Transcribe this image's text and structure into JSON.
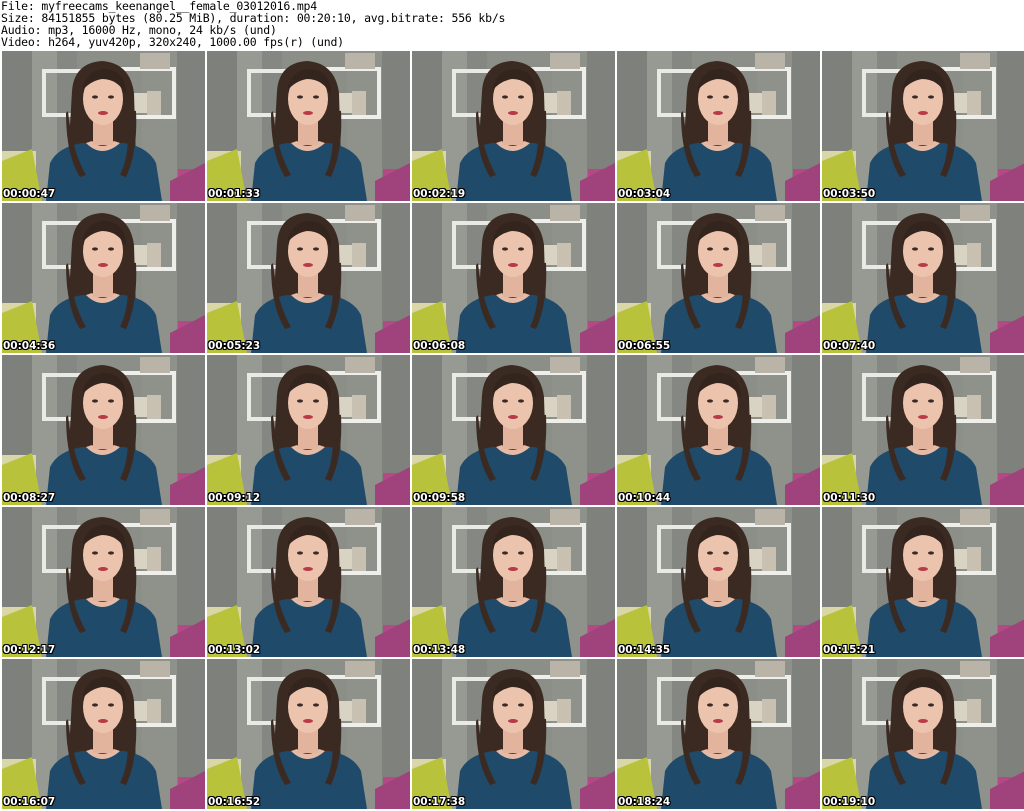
{
  "header": {
    "file_line": "File: myfreecams_keenangel__female_03012016.mp4",
    "size_line": "Size: 84151855 bytes (80.25 MiB), duration: 00:20:10, avg.bitrate: 556 kb/s",
    "audio_line": "Audio: mp3, 16000 Hz, mono, 24 kb/s (und)",
    "video_line": "Video: h264, yuv420p, 320x240, 1000.00 fps(r) (und)"
  },
  "thumbnails": [
    {
      "timestamp": "00:00:47"
    },
    {
      "timestamp": "00:01:33"
    },
    {
      "timestamp": "00:02:19"
    },
    {
      "timestamp": "00:03:04"
    },
    {
      "timestamp": "00:03:50"
    },
    {
      "timestamp": "00:04:36"
    },
    {
      "timestamp": "00:05:23"
    },
    {
      "timestamp": "00:06:08"
    },
    {
      "timestamp": "00:06:55"
    },
    {
      "timestamp": "00:07:40"
    },
    {
      "timestamp": "00:08:27"
    },
    {
      "timestamp": "00:09:12"
    },
    {
      "timestamp": "00:09:58"
    },
    {
      "timestamp": "00:10:44"
    },
    {
      "timestamp": "00:11:30"
    },
    {
      "timestamp": "00:12:17"
    },
    {
      "timestamp": "00:13:02"
    },
    {
      "timestamp": "00:13:48"
    },
    {
      "timestamp": "00:14:35"
    },
    {
      "timestamp": "00:15:21"
    },
    {
      "timestamp": "00:16:07"
    },
    {
      "timestamp": "00:16:52"
    },
    {
      "timestamp": "00:17:38"
    },
    {
      "timestamp": "00:18:24"
    },
    {
      "timestamp": "00:19:10"
    }
  ]
}
